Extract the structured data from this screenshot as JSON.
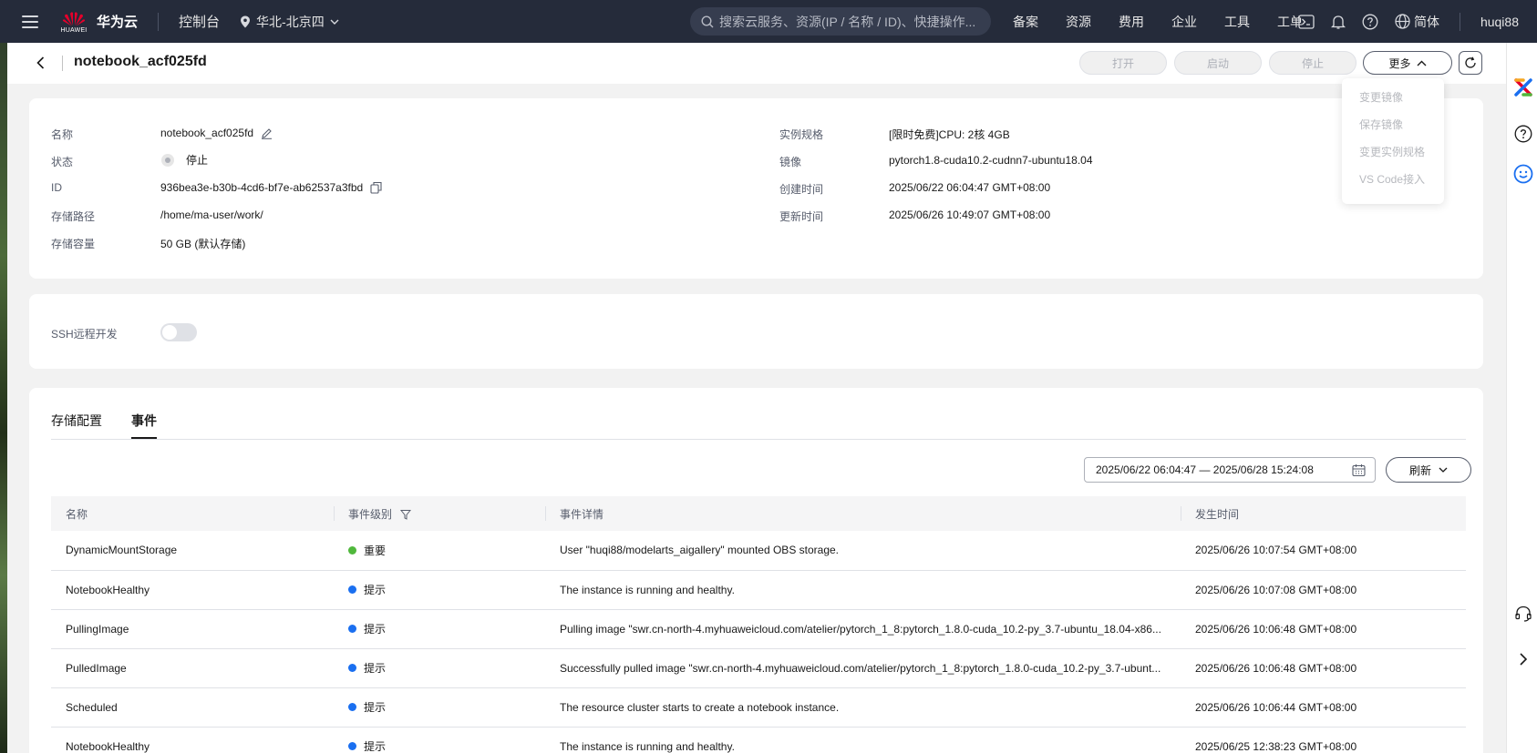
{
  "colors": {
    "topbar_bg": "#252b3a",
    "important": "#50b83c",
    "hint": "#1a6ff0",
    "huawei_red": "#e4002b"
  },
  "topbar": {
    "brand": "华为云",
    "brand_sub": "HUAWEI",
    "console": "控制台",
    "region": "华北-北京四",
    "search_placeholder": "搜索云服务、资源(IP / 名称 / ID)、快捷操作...",
    "nav": [
      "备案",
      "资源",
      "费用",
      "企业",
      "工具",
      "工单"
    ],
    "icons": [
      "terminal-icon",
      "bell-icon",
      "help-icon",
      "globe-icon"
    ],
    "lang": "简体",
    "user": "huqi88"
  },
  "header": {
    "title": "notebook_acf025fd",
    "buttons": {
      "open": "打开",
      "start": "启动",
      "stop": "停止",
      "more": "更多"
    }
  },
  "more_menu": [
    "变更镜像",
    "保存镜像",
    "变更实例规格",
    "VS Code接入"
  ],
  "details": {
    "left": [
      {
        "label": "名称",
        "value": "notebook_acf025fd"
      },
      {
        "label": "状态",
        "value": "停止"
      },
      {
        "label": "ID",
        "value": "936bea3e-b30b-4cd6-bf7e-ab62537a3fbd"
      },
      {
        "label": "存储路径",
        "value": "/home/ma-user/work/"
      },
      {
        "label": "存储容量",
        "value": "50 GB (默认存储)"
      }
    ],
    "right": [
      {
        "label": "实例规格",
        "value": "[限时免费]CPU: 2核 4GB"
      },
      {
        "label": "镜像",
        "value": "pytorch1.8-cuda10.2-cudnn7-ubuntu18.04"
      },
      {
        "label": "创建时间",
        "value": "2025/06/22 06:04:47 GMT+08:00"
      },
      {
        "label": "更新时间",
        "value": "2025/06/26 10:49:07 GMT+08:00"
      }
    ]
  },
  "ssh": {
    "label": "SSH远程开发",
    "enabled": false
  },
  "events": {
    "tabs": [
      "存储配置",
      "事件"
    ],
    "active_tab": "事件",
    "date_range": "2025/06/22 06:04:47 — 2025/06/28 15:24:08",
    "refresh": "刷新",
    "columns": [
      "名称",
      "事件级别",
      "事件详情",
      "发生时间"
    ],
    "rows": [
      {
        "name": "DynamicMountStorage",
        "level": "重要",
        "level_type": "important",
        "detail": "User \"huqi88/modelarts_aigallery\" mounted OBS storage.",
        "time": "2025/06/26 10:07:54 GMT+08:00"
      },
      {
        "name": "NotebookHealthy",
        "level": "提示",
        "level_type": "hint",
        "detail": "The instance is running and healthy.",
        "time": "2025/06/26 10:07:08 GMT+08:00"
      },
      {
        "name": "PullingImage",
        "level": "提示",
        "level_type": "hint",
        "detail": "Pulling image \"swr.cn-north-4.myhuaweicloud.com/atelier/pytorch_1_8:pytorch_1.8.0-cuda_10.2-py_3.7-ubuntu_18.04-x86...",
        "time": "2025/06/26 10:06:48 GMT+08:00"
      },
      {
        "name": "PulledImage",
        "level": "提示",
        "level_type": "hint",
        "detail": "Successfully pulled image \"swr.cn-north-4.myhuaweicloud.com/atelier/pytorch_1_8:pytorch_1.8.0-cuda_10.2-py_3.7-ubunt...",
        "time": "2025/06/26 10:06:48 GMT+08:00"
      },
      {
        "name": "Scheduled",
        "level": "提示",
        "level_type": "hint",
        "detail": "The resource cluster starts to create a notebook instance.",
        "time": "2025/06/26 10:06:44 GMT+08:00"
      },
      {
        "name": "NotebookHealthy",
        "level": "提示",
        "level_type": "hint",
        "detail": "The instance is running and healthy.",
        "time": "2025/06/25 12:38:23 GMT+08:00"
      }
    ]
  }
}
